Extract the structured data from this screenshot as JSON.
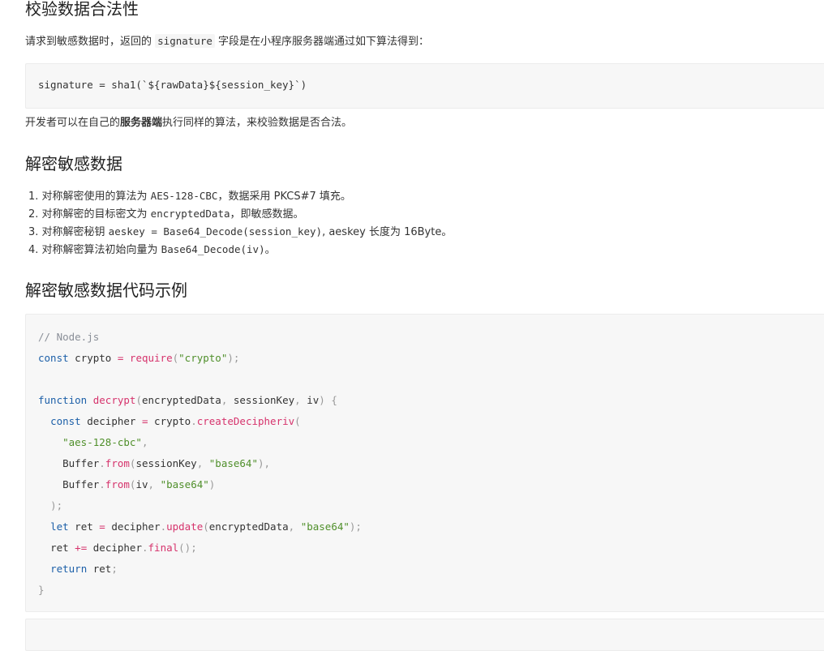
{
  "sections": {
    "verify": {
      "title": "校验数据合法性",
      "para1": {
        "prefix": "请求到敏感数据时，返回的 ",
        "code": "signature",
        "suffix": " 字段是在小程序服务器端通过如下算法得到："
      },
      "code_line": "signature = sha1(`${rawData}${session_key}`)",
      "para2": {
        "prefix": "开发者可以在自己的",
        "bold": "服务器端",
        "suffix": "执行同样的算法，来校验数据是否合法。"
      }
    },
    "decrypt": {
      "title": "解密敏感数据",
      "steps": [
        {
          "num": "1.",
          "pre": " 对称解密使用的算法为 ",
          "code": "AES-128-CBC",
          "post": "，数据采用 PKCS#7 填充。"
        },
        {
          "num": "2.",
          "pre": " 对称解密的目标密文为 ",
          "code": "encryptedData",
          "post": "，即敏感数据。"
        },
        {
          "num": "3.",
          "pre": " 对称解密秘钥 ",
          "code": "aeskey = Base64_Decode(session_key)",
          "post": ", aeskey 长度为 16Byte。"
        },
        {
          "num": "4.",
          "pre": " 对称解密算法初始向量为 ",
          "code": "Base64_Decode(iv)",
          "post": "。"
        }
      ]
    },
    "example": {
      "title": "解密敏感数据代码示例",
      "code": {
        "comment": "// Node.js",
        "const_kw": "const",
        "crypto_var": "crypto",
        "eq": "=",
        "require_fn": "require",
        "crypto_str": "\"crypto\"",
        "function_kw": "function",
        "decrypt_fn": "decrypt",
        "p_encrypted": "encryptedData",
        "p_session": "sessionKey",
        "p_iv": "iv",
        "decipher_var": "decipher",
        "create_fn": "createDecipheriv",
        "algo_str": "\"aes-128-cbc\"",
        "buffer": "Buffer",
        "from_fn": "from",
        "b64_str": "\"base64\"",
        "let_kw": "let",
        "ret_var": "ret",
        "update_fn": "update",
        "pluseq": "+=",
        "final_fn": "final",
        "return_kw": "return"
      }
    }
  }
}
